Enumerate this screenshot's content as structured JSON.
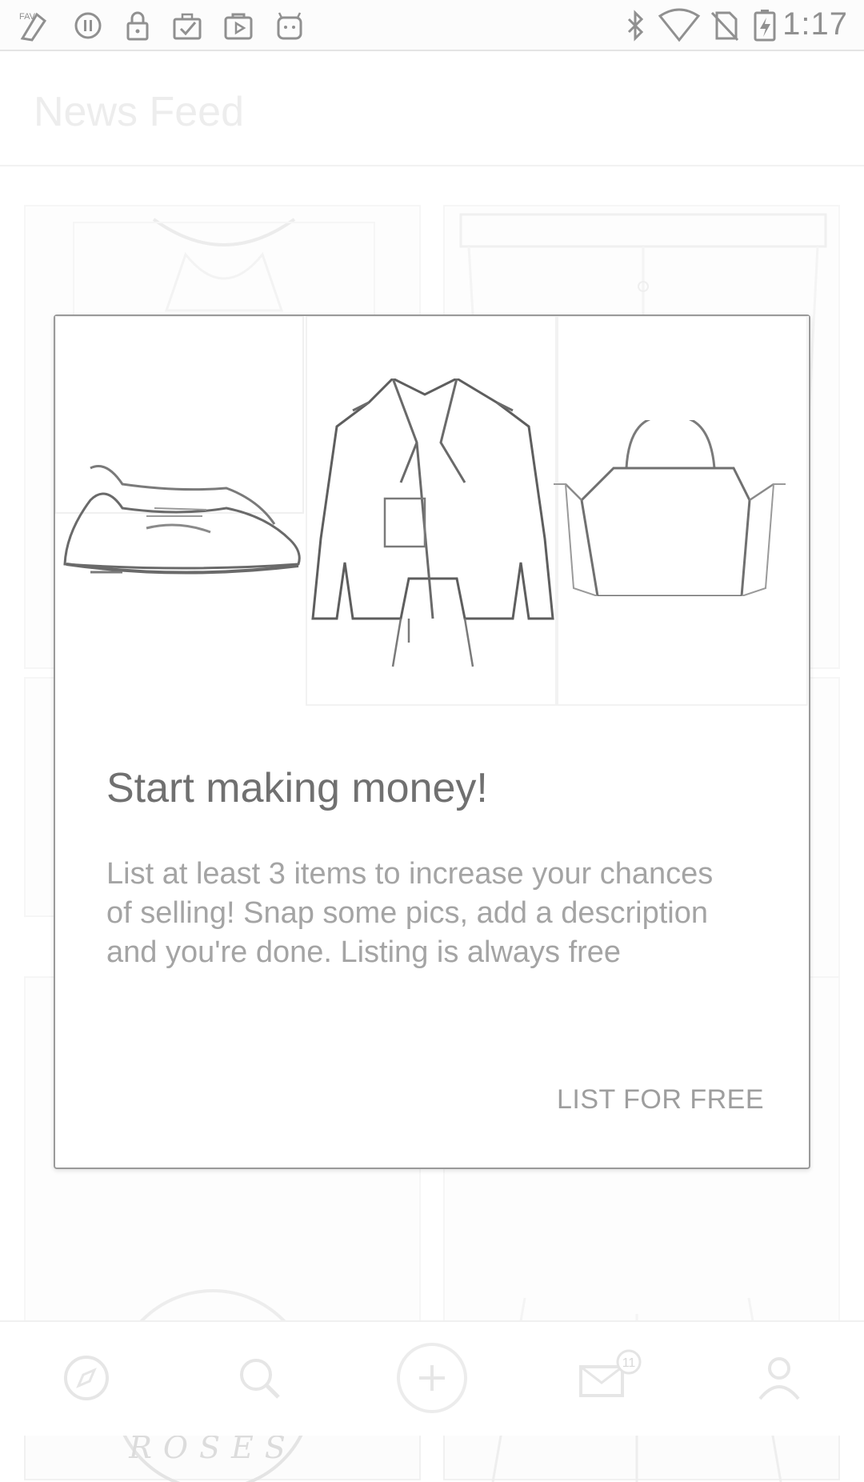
{
  "status_bar": {
    "time": "1:17",
    "left_icons": [
      "fast-app-icon",
      "circle-pause-icon",
      "lock-icon",
      "clipboard-check-icon",
      "play-store-icon",
      "android-robot-icon"
    ],
    "right_icons": [
      "bluetooth-icon",
      "wifi-icon",
      "no-sim-icon",
      "battery-charging-icon"
    ]
  },
  "app_bar": {
    "title": "News Feed"
  },
  "dialog": {
    "title": "Start making money!",
    "body": "List at least 3 items to increase your chances of selling! Snap some pics, add a description and you're done. Listing is always free",
    "action_label": "LIST FOR FREE",
    "hero_images": [
      "sneakers",
      "leather-jacket",
      "handbag"
    ]
  },
  "feed": {
    "card_caption": "ROSES"
  },
  "bottom_nav": {
    "items": [
      "compass-icon",
      "search-icon",
      "add-listing-icon",
      "messages-icon",
      "profile-icon"
    ],
    "messages_badge": "11"
  }
}
